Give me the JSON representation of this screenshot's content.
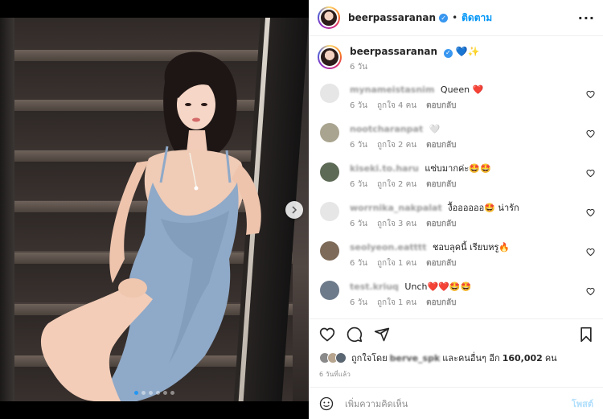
{
  "post": {
    "author": "beerpassaranan",
    "follow_label": "ติดตาม",
    "separator": "•",
    "caption_emoji": "💙✨",
    "caption_time": "6 วัน"
  },
  "comments": [
    {
      "user": "mynameistasnim",
      "text": "Queen ❤️",
      "time": "6 วัน",
      "likes": "ถูกใจ 4 คน",
      "reply": "ตอบกลับ",
      "avatar_color": "#e6e6e6"
    },
    {
      "user": "nootcharanpat",
      "text": "🤍",
      "time": "6 วัน",
      "likes": "ถูกใจ 2 คน",
      "reply": "ตอบกลับ",
      "avatar_color": "#a9a48f"
    },
    {
      "user": "kiseki.to.haru",
      "text": "แซ่บมากค่ะ🤩🤩",
      "time": "6 วัน",
      "likes": "ถูกใจ 2 คน",
      "reply": "ตอบกลับ",
      "avatar_color": "#5d6a55"
    },
    {
      "user": "worrnika_nakpalat",
      "text": "งื้ออออออ🤩 น่ารัก",
      "time": "6 วัน",
      "likes": "ถูกใจ 3 คน",
      "reply": "ตอบกลับ",
      "avatar_color": "#e6e6e6"
    },
    {
      "user": "seolyeon.eatttt",
      "text": "ชอบลุคนี้ เรียบหรู🔥",
      "time": "6 วัน",
      "likes": "ถูกใจ 1 คน",
      "reply": "ตอบกลับ",
      "avatar_color": "#7d6a58"
    },
    {
      "user": "test.kriuq",
      "text": "Unch❤️❤️🤩🤩",
      "time": "6 วัน",
      "likes": "ถูกใจ 1 คน",
      "reply": "ตอบกลับ",
      "avatar_color": "#6d7a8a"
    }
  ],
  "likes": {
    "prefix": "ถูกใจโดย",
    "user": "berve_spk",
    "middle": "และคนอื่นๆ อีก",
    "count": "160,002",
    "suffix": "คน"
  },
  "time_ago": "6 วันที่แล้ว",
  "add_comment": {
    "placeholder": "เพิ่มความคิดเห็น",
    "post_label": "โพสต์"
  },
  "icons": {
    "heart": "heart-icon",
    "comment": "comment-icon",
    "share": "share-icon",
    "save": "bookmark-icon",
    "emoji": "emoji-icon",
    "more": "more-icon",
    "next": "chevron-right-icon"
  },
  "carousel": {
    "total_slides": 6,
    "active_index": 0
  },
  "colors": {
    "link_blue": "#0095f6",
    "verified_blue": "#3897f0",
    "muted_text": "#8e8e8e",
    "carousel_active": "#2196f3"
  }
}
